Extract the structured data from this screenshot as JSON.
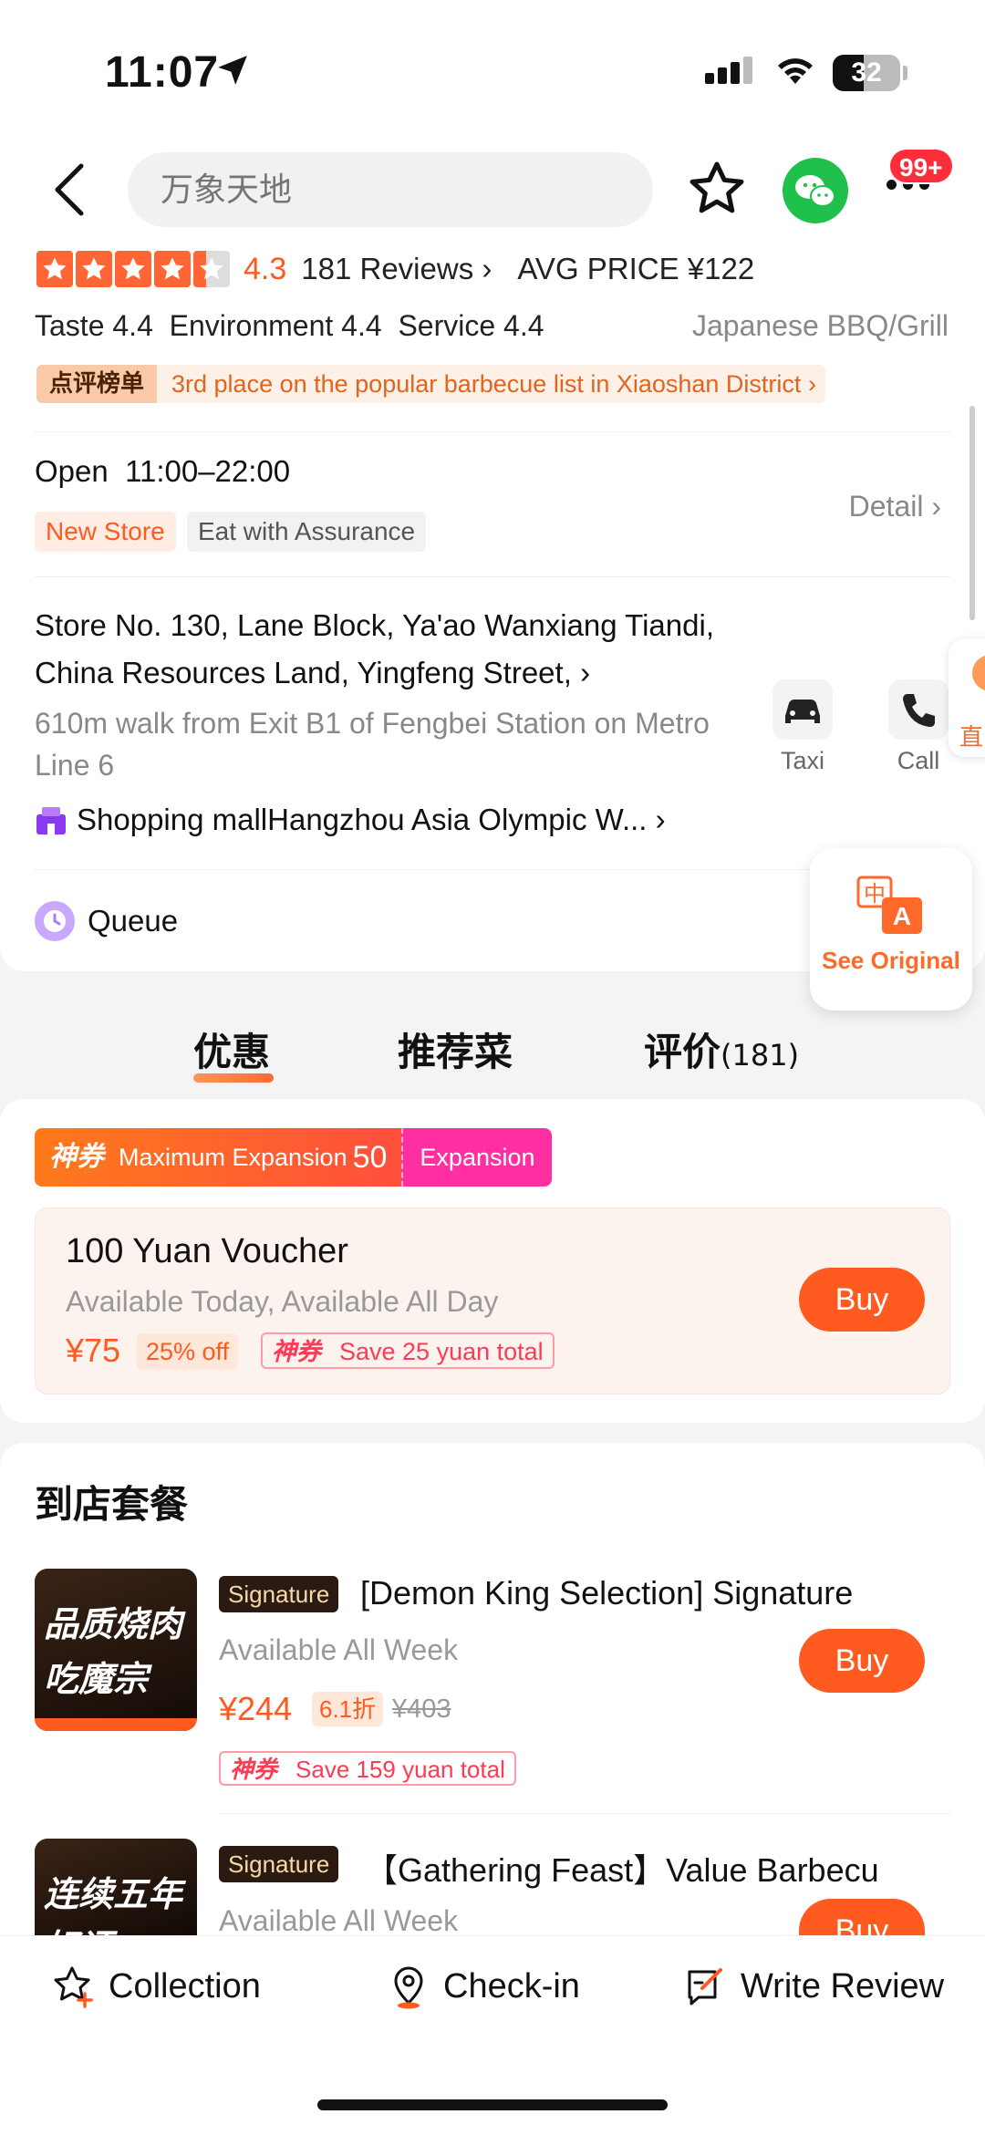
{
  "status_bar": {
    "time": "11:07",
    "battery": "32"
  },
  "header": {
    "search_placeholder": "万象天地",
    "notification_badge": "99+"
  },
  "shop": {
    "rating": "4.3",
    "reviews_link": "181 Reviews",
    "avg_price": "AVG PRICE ¥122",
    "sub_scores": "Taste 4.4  Environment 4.4  Service 4.4",
    "cuisine": "Japanese BBQ/Grill",
    "rank_badge": "点评榜单",
    "rank_text": "3rd place on the popular barbecue list in Xiaoshan District",
    "hours": "Open  11:00–22:00",
    "tags": [
      "New Store",
      "Eat with Assurance"
    ],
    "detail_link": "Detail",
    "address": "Store No. 130, Lane Block, Ya'ao Wanxiang Tiandi, China Resources Land, Yingfeng Street,",
    "walk": "610m walk from Exit B1 of Fengbei Station on Metro Line 6",
    "mall": "Shopping mallHangzhou Asia Olympic W...",
    "queue": "Queue",
    "actions": {
      "taxi": "Taxi",
      "call": "Call",
      "side_peek": "直"
    }
  },
  "translate": {
    "label": "See Original"
  },
  "tabs": [
    {
      "label": "优惠"
    },
    {
      "label": "推荐菜"
    },
    {
      "label": "评价",
      "count": "(181)"
    }
  ],
  "expansion": {
    "brand": "神券",
    "text": "Maximum Expansion",
    "amount": "50",
    "button": "Expansion"
  },
  "voucher": {
    "title": "100 Yuan Voucher",
    "availability": "Available Today, Available All Day",
    "price": "¥75",
    "discount": "25% off",
    "save_brand": "神券",
    "save_text": "Save 25 yuan total",
    "buy": "Buy"
  },
  "packages": {
    "heading": "到店套餐",
    "items": [
      {
        "badge": "Signature",
        "title": "[Demon King Selection] Signature",
        "availability": "Available All Week",
        "price": "¥244",
        "discount": "6.1折",
        "original": "¥403",
        "save_brand": "神券",
        "save_text": "Save 159 yuan total",
        "image_line1": "品质烧肉",
        "image_line2": "吃魔宗",
        "buy": "Buy"
      },
      {
        "badge": "Signature",
        "title": "【Gathering Feast】Value Barbecu",
        "availability": "Available All Week",
        "image_line1": "连续五年",
        "image_line2": "好评一",
        "buy": "Buy"
      }
    ]
  },
  "bottom_bar": {
    "collection": "Collection",
    "checkin": "Check-in",
    "review": "Write Review"
  },
  "colors": {
    "accent": "#ff5a1f",
    "wechat": "#1fc14c",
    "pink": "#ff2fa2"
  }
}
